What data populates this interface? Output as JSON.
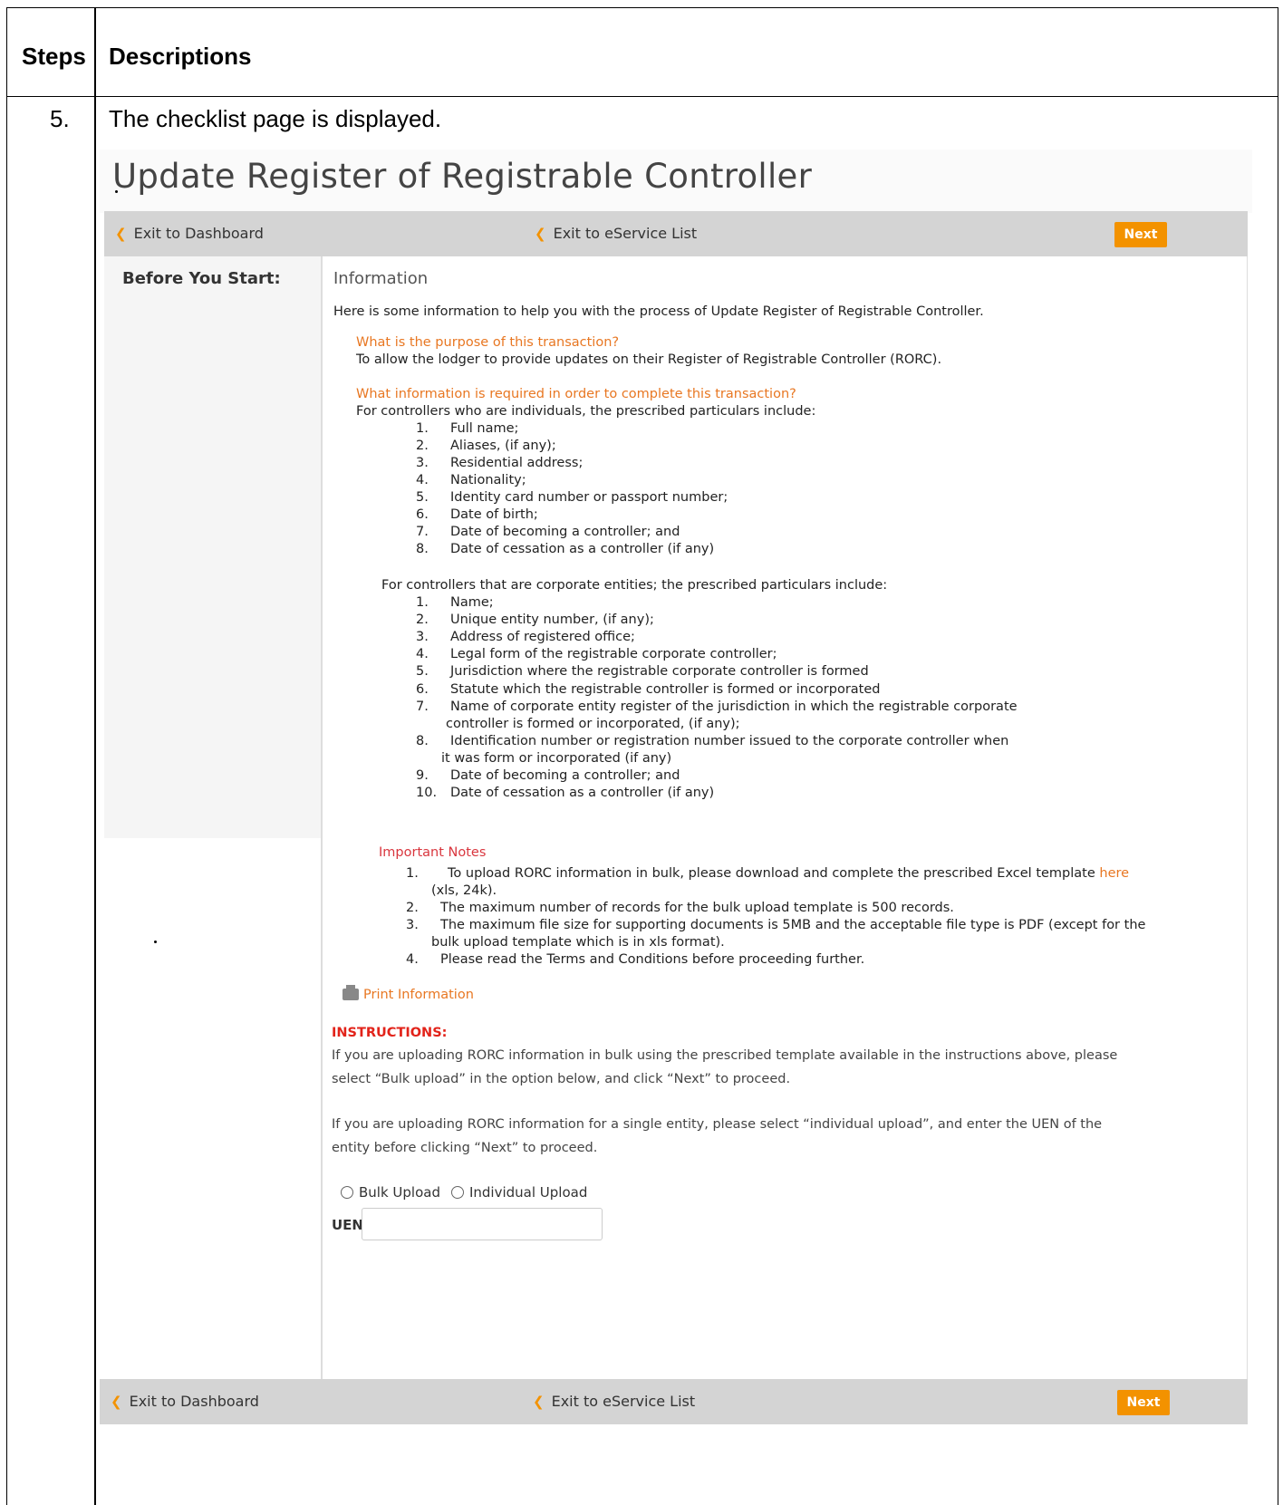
{
  "doc": {
    "col_steps": "Steps",
    "col_desc": "Descriptions",
    "step_number": "5.",
    "step_text": "The checklist page is displayed."
  },
  "page": {
    "title": "Update Register of Registrable Controller",
    "toolbar": {
      "exit_dashboard": "Exit to Dashboard",
      "exit_eservice": "Exit to eService List",
      "next": "Next"
    },
    "sidebar_title": "Before You Start:",
    "info_heading": "Information",
    "intro": "Here is some information to help you with the process of Update Register of Registrable Controller.",
    "q1": "What is the purpose of this transaction?",
    "a1": "To allow the lodger to provide updates on their Register of Registrable Controller (RORC).",
    "q2": "What information is required in order to complete this transaction?",
    "individuals_intro": "For controllers who are individuals, the prescribed particulars include:",
    "individuals": [
      {
        "num": "1.",
        "text": "Full name;"
      },
      {
        "num": "2.",
        "text": "Aliases, (if any);"
      },
      {
        "num": "3.",
        "text": "Residential address;"
      },
      {
        "num": "4.",
        "text": "Nationality;"
      },
      {
        "num": "5.",
        "text": "Identity card number or passport number;"
      },
      {
        "num": "6.",
        "text": "Date of birth;"
      },
      {
        "num": "7.",
        "text": "Date of becoming a controller; and"
      },
      {
        "num": "8.",
        "text": "Date of cessation as a controller (if any)"
      }
    ],
    "corporate_intro": "For controllers that are corporate entities; the prescribed particulars include:",
    "corporate": [
      {
        "num": "1.",
        "text": "Name;"
      },
      {
        "num": "2.",
        "text": "Unique entity number, (if any);"
      },
      {
        "num": "3.",
        "text": "Address of registered office;"
      },
      {
        "num": "4.",
        "text": "Legal form of the registrable corporate controller;"
      },
      {
        "num": "5.",
        "text": "Jurisdiction where the registrable corporate controller is formed"
      },
      {
        "num": "6.",
        "text": " Statute which the registrable controller is formed or incorporated"
      },
      {
        "num": "7.",
        "text": "Name of corporate entity register of the jurisdiction in which the registrable corporate",
        "cont": "controller is formed or incorporated, (if any);"
      },
      {
        "num": "8.",
        "text": "Identification number or registration number issued to the corporate controller when",
        "cont": "it was form or incorporated (if any)"
      },
      {
        "num": "9.",
        "text": "Date of becoming a controller; and"
      },
      {
        "num": "10.",
        "text": "Date of cessation as a controller (if any)"
      }
    ],
    "notes_heading": "Important Notes",
    "notes": {
      "n1_num": "1.",
      "n1_text": "To upload RORC information in bulk, please download and complete the prescribed Excel template",
      "n1_link": "here",
      "n1_cont": "(xls, 24k).",
      "n2_num": "2.",
      "n2_text": "The maximum number of records for the bulk upload template is 500 records.",
      "n3_num": "3.",
      "n3_text": "The maximum file size for supporting documents is 5MB and the acceptable file type is PDF (except for the",
      "n3_cont": "bulk upload template which is in xls format).",
      "n4_num": "4.",
      "n4_text": "Please read the Terms and Conditions before proceeding further."
    },
    "print_info": "Print Information",
    "instructions_heading": "INSTRUCTIONS:",
    "instr1_line1": "If you are uploading RORC information in bulk using the prescribed template available in the instructions above, please",
    "instr1_line2": "select “Bulk upload” in the option below, and click “Next” to proceed.",
    "instr2_line1": "If you are uploading RORC information for a single entity, please select “individual upload”, and enter the UEN of the",
    "instr2_line2": "entity before clicking “Next” to proceed.",
    "radio_bulk": "Bulk Upload",
    "radio_individual": "Individual Upload",
    "uen_label": "UEN"
  }
}
